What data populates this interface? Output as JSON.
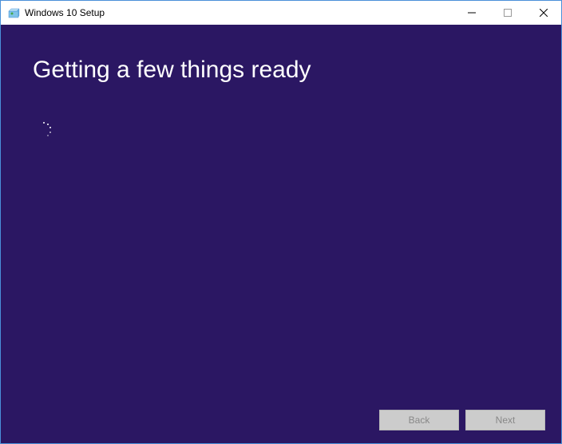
{
  "titlebar": {
    "title": "Windows 10 Setup"
  },
  "content": {
    "heading": "Getting a few things ready"
  },
  "footer": {
    "back_label": "Back",
    "next_label": "Next"
  }
}
